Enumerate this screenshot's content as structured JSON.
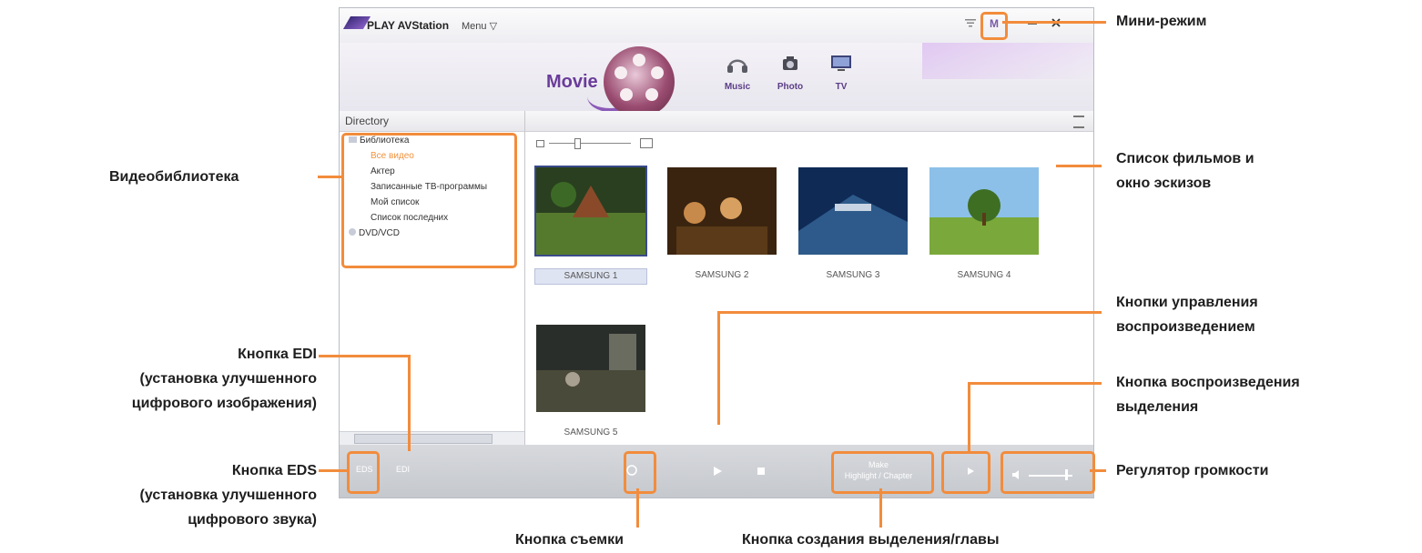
{
  "app": {
    "title": "PLAY AVStation",
    "menu_label": "Menu ▽",
    "mini_mode_label": "M",
    "filter_icon": "filter-icon",
    "minimize_icon": "minimize-icon",
    "close_icon": "close-icon",
    "accent_color": "#6a3c9a"
  },
  "media_tabs": {
    "active": "Movie",
    "items": [
      {
        "label": "Music",
        "icon": "headphones-icon"
      },
      {
        "label": "Photo",
        "icon": "camera-icon"
      },
      {
        "label": "TV",
        "icon": "tv-icon"
      }
    ]
  },
  "sidebar": {
    "header": "Directory",
    "tree": [
      {
        "label": "Библиотека",
        "icon": "folder-icon"
      },
      {
        "label": "Все видео",
        "selected": true
      },
      {
        "label": "Актер"
      },
      {
        "label": "Записанные ТВ-программы"
      },
      {
        "label": "Мой список"
      },
      {
        "label": "Список последних"
      },
      {
        "label": "DVD/VCD",
        "icon": "disc-icon"
      }
    ]
  },
  "thumbnails": [
    {
      "caption": "SAMSUNG 1",
      "selected": true
    },
    {
      "caption": "SAMSUNG 2"
    },
    {
      "caption": "SAMSUNG 3"
    },
    {
      "caption": "SAMSUNG 4"
    },
    {
      "caption": "SAMSUNG 5"
    }
  ],
  "bottombar": {
    "eds_label": "EDS",
    "edi_label": "EDI",
    "highlight_line1": "Make",
    "highlight_line2": "Highlight / Chapter"
  },
  "callouts": {
    "mini_mode": "Мини-режим",
    "video_library": "Видеобиблиотека",
    "movie_list_1": "Список фильмов и",
    "movie_list_2": "окно эскизов",
    "playback_controls_1": "Кнопки управления",
    "playback_controls_2": "воспроизведением",
    "highlight_play_1": "Кнопка воспроизведения",
    "highlight_play_2": "выделения",
    "volume": "Регулятор громкости",
    "edi_1": "Кнопка EDI",
    "edi_2": "(установка улучшенного",
    "edi_3": "цифрового изображения)",
    "eds_1": "Кнопка EDS",
    "eds_2": "(установка улучшенного",
    "eds_3": "цифрового звука)",
    "capture": "Кнопка съемки",
    "make_highlight": "Кнопка создания выделения/главы"
  }
}
